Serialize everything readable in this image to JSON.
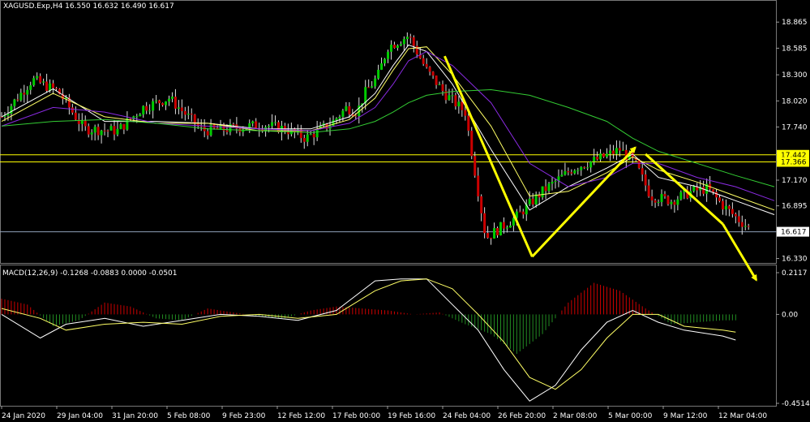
{
  "header": {
    "symbol_line": "XAGUSD.Exp,H4  16.550 16.632 16.490 16.617"
  },
  "indicator": {
    "label": "MACD(12,26,9) -0.1268 -0.0883 0.0000 -0.0501"
  },
  "colors": {
    "background": "#000000",
    "bull_candle": "#00cc00",
    "bear_candle": "#cc0000",
    "candle_wick": "#dddddd",
    "ma_fast": "#ffffff",
    "ma_medium": "#ffff66",
    "ma_slow": "#8a2be2",
    "ma_long": "#33cc33",
    "level_lines": "#ffff00",
    "current_price_line": "#8f9fb8",
    "arrows": "#ffff00",
    "macd_positive": "#cc0000",
    "macd_negative": "#228b22",
    "macd_main": "#ffffff",
    "macd_signal": "#ffff66"
  },
  "chart_data": [
    {
      "type": "candlestick",
      "title": "XAGUSD.Exp,H4",
      "ohlc_current": {
        "open": 16.55,
        "high": 16.632,
        "low": 16.49,
        "close": 16.617
      },
      "y_ticks": [
        "18.865",
        "18.585",
        "18.300",
        "18.020",
        "17.740",
        "17.455",
        "17.170",
        "16.895",
        "16.617",
        "16.330"
      ],
      "x_tick_labels": [
        "24 Jan 2020",
        "29 Jan 04:00",
        "31 Jan 20:00",
        "5 Feb 08:00",
        "9 Feb 23:00",
        "12 Feb 12:00",
        "17 Feb 00:00",
        "19 Feb 16:00",
        "24 Feb 04:00",
        "26 Feb 20:00",
        "2 Mar 08:00",
        "5 Mar 00:00",
        "9 Mar 12:00",
        "12 Mar 04:00"
      ],
      "ylim": [
        16.3,
        18.98
      ],
      "close_path_x": [
        0,
        12,
        22,
        32,
        45,
        55,
        65,
        78,
        88,
        96,
        102,
        110,
        118,
        128,
        134,
        138,
        141,
        146,
        150,
        158,
        165,
        172,
        180,
        188,
        200
      ],
      "close_path_y": [
        17.85,
        18.25,
        18.12,
        17.72,
        17.7,
        17.95,
        18.05,
        17.7,
        17.72,
        17.75,
        17.76,
        17.72,
        17.62,
        17.78,
        17.95,
        17.9,
        18.1,
        18.28,
        18.6,
        18.72,
        18.35,
        18.1,
        17.9,
        16.55,
        16.78
      ],
      "close_path_x_cont": [
        210,
        222,
        232,
        240,
        246,
        252,
        260,
        268,
        274,
        280,
        286,
        292,
        300
      ],
      "close_path_y_cont": [
        17.05,
        17.3,
        17.4,
        17.5,
        17.35,
        17.0,
        16.95,
        17.05,
        17.08,
        16.9,
        16.75,
        16.62,
        16.62
      ],
      "horizontal_levels": [
        {
          "label": "17.442",
          "value": 17.442
        },
        {
          "label": "17.366",
          "value": 17.366
        },
        {
          "label": "16.617",
          "value": 16.617
        }
      ],
      "moving_averages": [
        {
          "x": [
            0,
            20,
            40,
            60,
            80,
            100,
            120,
            135,
            145,
            152,
            158,
            165,
            175,
            190,
            205,
            220,
            235,
            245,
            255,
            270,
            285,
            300
          ],
          "y": [
            17.85,
            18.15,
            17.8,
            17.8,
            17.78,
            17.72,
            17.72,
            17.85,
            18.1,
            18.4,
            18.62,
            18.55,
            18.2,
            17.5,
            16.85,
            17.1,
            17.3,
            17.45,
            17.2,
            17.1,
            16.95,
            16.8
          ]
        },
        {
          "x": [
            0,
            20,
            40,
            60,
            80,
            100,
            120,
            135,
            145,
            152,
            158,
            165,
            175,
            190,
            205,
            220,
            235,
            245,
            255,
            270,
            285,
            300
          ],
          "y": [
            17.8,
            18.1,
            17.85,
            17.78,
            17.78,
            17.7,
            17.7,
            17.82,
            18.05,
            18.35,
            18.58,
            18.6,
            18.3,
            17.75,
            17.0,
            17.05,
            17.25,
            17.42,
            17.28,
            17.15,
            17.0,
            16.85
          ]
        },
        {
          "x": [
            0,
            20,
            40,
            60,
            80,
            100,
            120,
            135,
            145,
            152,
            158,
            165,
            175,
            190,
            205,
            220,
            235,
            245,
            255,
            270,
            285,
            300
          ],
          "y": [
            17.75,
            17.95,
            17.9,
            17.78,
            17.75,
            17.72,
            17.7,
            17.78,
            17.95,
            18.2,
            18.45,
            18.55,
            18.4,
            18.0,
            17.35,
            17.1,
            17.2,
            17.35,
            17.35,
            17.2,
            17.1,
            16.95
          ]
        },
        {
          "x": [
            0,
            20,
            40,
            60,
            80,
            100,
            120,
            135,
            145,
            152,
            158,
            165,
            175,
            190,
            205,
            220,
            235,
            245,
            255,
            270,
            285,
            300
          ],
          "y": [
            17.75,
            17.8,
            17.82,
            17.78,
            17.72,
            17.7,
            17.68,
            17.72,
            17.8,
            17.9,
            18.0,
            18.08,
            18.12,
            18.14,
            18.08,
            17.95,
            17.8,
            17.62,
            17.48,
            17.35,
            17.22,
            17.1
          ]
        }
      ],
      "arrows": [
        {
          "from": [
            172,
            18.5
          ],
          "to": [
            206,
            16.35
          ]
        },
        {
          "from": [
            206,
            16.35
          ],
          "to": [
            246,
            17.52
          ]
        },
        {
          "from": [
            250,
            17.45
          ],
          "to": [
            280,
            16.7
          ]
        },
        {
          "from": [
            280,
            16.7
          ],
          "to": [
            293,
            16.1
          ]
        }
      ]
    },
    {
      "type": "bar",
      "title": "MACD(12,26,9)",
      "values_current": {
        "main": -0.1268,
        "signal": -0.0883,
        "zero": 0.0,
        "histogram": -0.0501
      },
      "y_ticks": [
        "0.2117",
        "0.00",
        "-0.4514"
      ],
      "ylim": [
        -0.4514,
        0.2117
      ],
      "histogram_x": [
        0,
        10,
        20,
        30,
        40,
        50,
        60,
        70,
        80,
        90,
        100,
        110,
        120,
        130,
        140,
        150,
        160,
        170,
        180,
        190,
        200,
        210,
        220,
        230,
        240,
        250,
        260,
        270,
        280
      ],
      "histogram": [
        0.08,
        0.05,
        -0.06,
        -0.03,
        0.06,
        0.04,
        -0.02,
        -0.03,
        0.03,
        0.01,
        -0.01,
        -0.02,
        0.02,
        0.04,
        0.03,
        0.02,
        0.0,
        0.01,
        -0.05,
        -0.1,
        -0.2,
        -0.1,
        0.06,
        0.16,
        0.12,
        0.03,
        -0.05,
        -0.04,
        -0.03
      ],
      "macd_x": [
        0,
        15,
        25,
        40,
        55,
        70,
        85,
        100,
        115,
        130,
        145,
        155,
        165,
        175,
        185,
        195,
        205,
        215,
        225,
        235,
        245,
        255,
        265,
        280,
        285
      ],
      "macd_main": [
        0.0,
        -0.12,
        -0.05,
        -0.02,
        -0.06,
        -0.03,
        0.0,
        -0.01,
        -0.03,
        0.02,
        0.17,
        0.18,
        0.18,
        0.05,
        -0.08,
        -0.28,
        -0.44,
        -0.36,
        -0.18,
        -0.04,
        0.02,
        -0.04,
        -0.08,
        -0.11,
        -0.13
      ],
      "macd_signal": [
        0.03,
        -0.02,
        -0.08,
        -0.05,
        -0.04,
        -0.05,
        -0.01,
        0.0,
        -0.02,
        0.0,
        0.12,
        0.17,
        0.18,
        0.13,
        0.0,
        -0.14,
        -0.32,
        -0.38,
        -0.28,
        -0.12,
        0.0,
        0.0,
        -0.06,
        -0.08,
        -0.09
      ]
    }
  ]
}
